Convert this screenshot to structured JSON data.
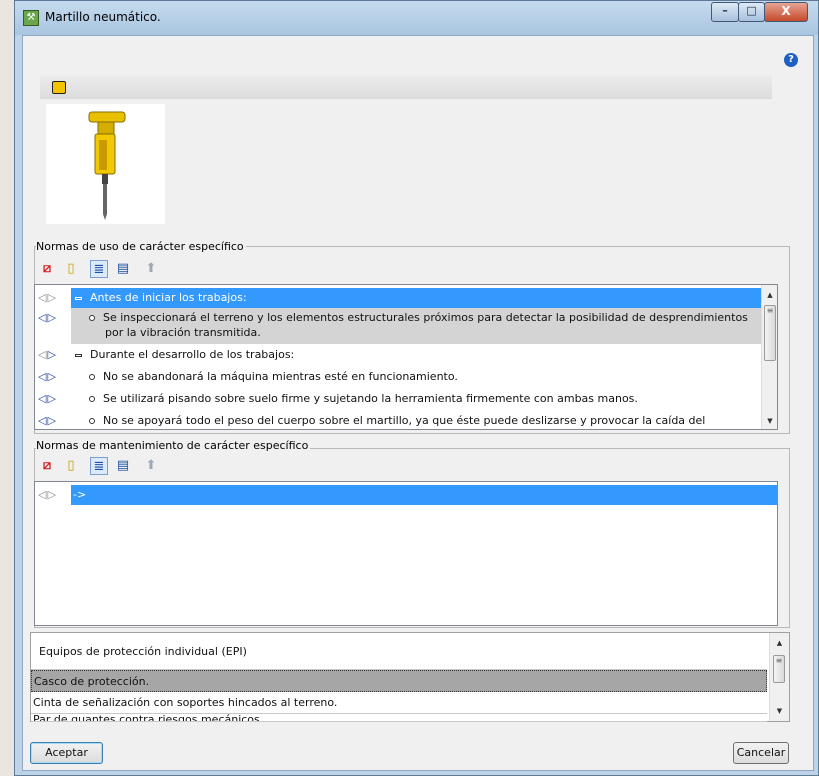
{
  "window": {
    "title": "Martillo neumático.",
    "controls": {
      "minimize": "–",
      "maximize": "□",
      "close": "X"
    },
    "help_icon": "?"
  },
  "image_panel": {
    "edit_icon": "edit-image-icon",
    "image": "pneumatic-hammer-image"
  },
  "usage_rules": {
    "title": "Normas de uso de carácter específico",
    "toolbar": [
      "delete-icon",
      "new-document-icon",
      "list-view-icon",
      "text-view-icon",
      "move-up-icon"
    ],
    "rows": [
      {
        "text": "Antes de iniciar los trabajos:",
        "level": 0,
        "selected": true
      },
      {
        "text": "Se inspeccionará el terreno y los elementos estructurales próximos para detectar la posibilidad de desprendimientos",
        "text2": "por la vibración transmitida.",
        "level": 1
      },
      {
        "text": "Durante el desarrollo de los trabajos:",
        "level": 0
      },
      {
        "text": "No se abandonará la máquina mientras esté en funcionamiento.",
        "level": 1
      },
      {
        "text": "Se utilizará pisando sobre suelo firme y sujetando la herramienta firmemente con ambas manos.",
        "level": 1
      },
      {
        "text": "No se apoyará todo el peso del cuerpo sobre el martillo, ya que éste puede deslizarse y provocar la caída del",
        "level": 1
      }
    ]
  },
  "maintenance_rules": {
    "title": "Normas de mantenimiento de carácter específico",
    "rows": [
      {
        "text": "->",
        "selected": true
      }
    ]
  },
  "epi": {
    "header": "Equipos de protección individual (EPI)",
    "items": [
      "Casco de protección.",
      "Cinta de señalización con soportes hincados al terreno.",
      "Par de guantes contra riesgos mecánicos."
    ]
  },
  "buttons": {
    "accept": "Aceptar",
    "cancel": "Cancelar"
  },
  "colors": {
    "selection": "#3399ff",
    "title_bar": "#bdd3e8"
  }
}
